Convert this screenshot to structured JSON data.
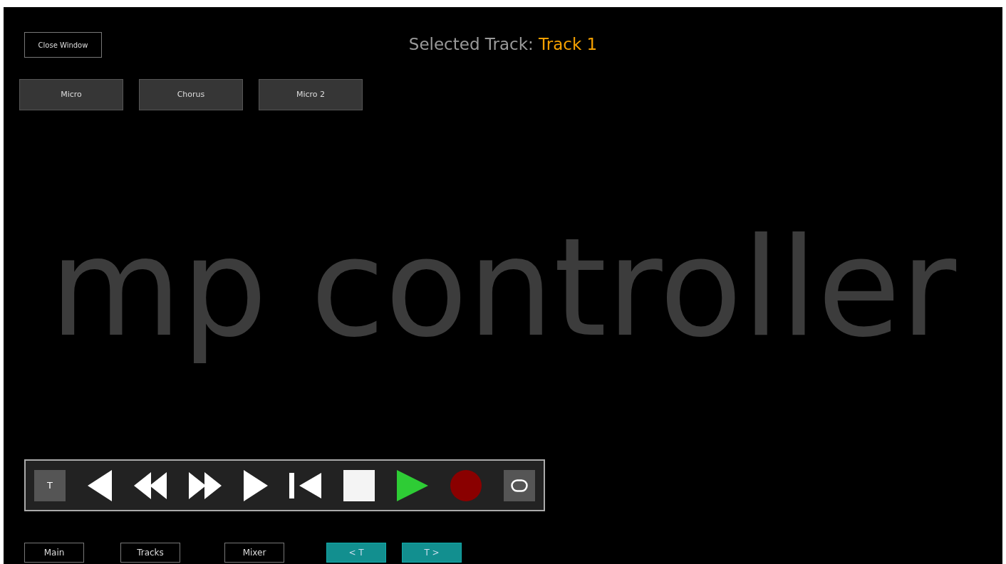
{
  "close_button": "Close Window",
  "selected_track": {
    "label": "Selected Track:",
    "value": "Track 1"
  },
  "effects": [
    "Micro",
    "Chorus",
    "Micro 2"
  ],
  "logo": "mp controller",
  "transport": [
    {
      "kind": "text",
      "label": "T"
    },
    {
      "kind": "previous"
    },
    {
      "kind": "rewind"
    },
    {
      "kind": "forward"
    },
    {
      "kind": "next"
    },
    {
      "kind": "start"
    },
    {
      "kind": "stop"
    },
    {
      "kind": "play"
    },
    {
      "kind": "record"
    },
    {
      "kind": "loop"
    }
  ],
  "nav": [
    {
      "label": "Main",
      "kind": "outline"
    },
    {
      "label": "Tracks",
      "kind": "outline"
    },
    {
      "label": "Mixer",
      "kind": "outline"
    },
    {
      "label": "< T",
      "kind": "accent"
    },
    {
      "label": "T >",
      "kind": "accent"
    }
  ]
}
